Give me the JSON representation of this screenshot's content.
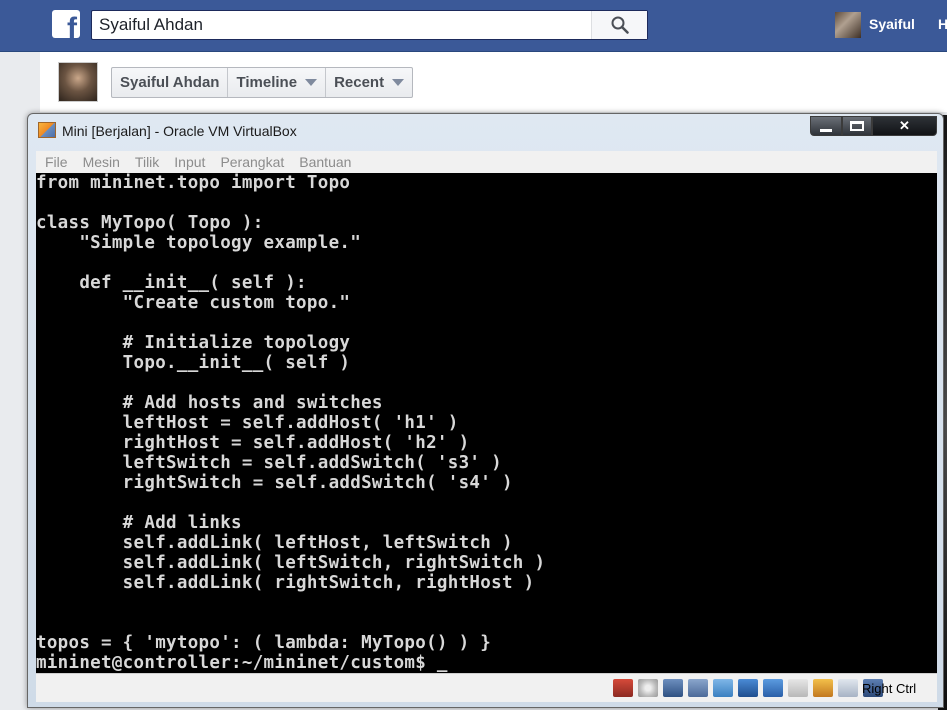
{
  "facebook": {
    "search": {
      "value": "Syaiful Ahdan"
    },
    "user": {
      "name": "Syaiful",
      "next_link": "H"
    },
    "nav": {
      "items": [
        {
          "label": "Syaiful Ahdan"
        },
        {
          "label": "Timeline"
        },
        {
          "label": "Recent"
        }
      ]
    }
  },
  "virtualbox": {
    "title": "Mini [Berjalan] - Oracle VM VirtualBox",
    "menu": [
      "File",
      "Mesin",
      "Tilik",
      "Input",
      "Perangkat",
      "Bantuan"
    ],
    "console_lines": [
      "from mininet.topo import Topo",
      "",
      "class MyTopo( Topo ):",
      "    \"Simple topology example.\"",
      "",
      "    def __init__( self ):",
      "        \"Create custom topo.\"",
      "",
      "        # Initialize topology",
      "        Topo.__init__( self )",
      "",
      "        # Add hosts and switches",
      "        leftHost = self.addHost( 'h1' )",
      "        rightHost = self.addHost( 'h2' )",
      "        leftSwitch = self.addSwitch( 's3' )",
      "        rightSwitch = self.addSwitch( 's4' )",
      "",
      "        # Add links",
      "        self.addLink( leftHost, leftSwitch )",
      "        self.addLink( leftSwitch, rightSwitch )",
      "        self.addLink( rightSwitch, rightHost )",
      "",
      "",
      "topos = { 'mytopo': ( lambda: MyTopo() ) }",
      "mininet@controller:~/mininet/custom$ _"
    ],
    "status": {
      "icons": [
        "hard-disk-icon",
        "optical-drive-icon",
        "audio-icon",
        "usb-icon",
        "shared-folders-icon",
        "display-icon",
        "network-icon",
        "video-capture-icon",
        "cpu-icon",
        "mouse-integration-icon",
        "keyboard-capture-icon"
      ],
      "host_key": "Right Ctrl"
    }
  }
}
